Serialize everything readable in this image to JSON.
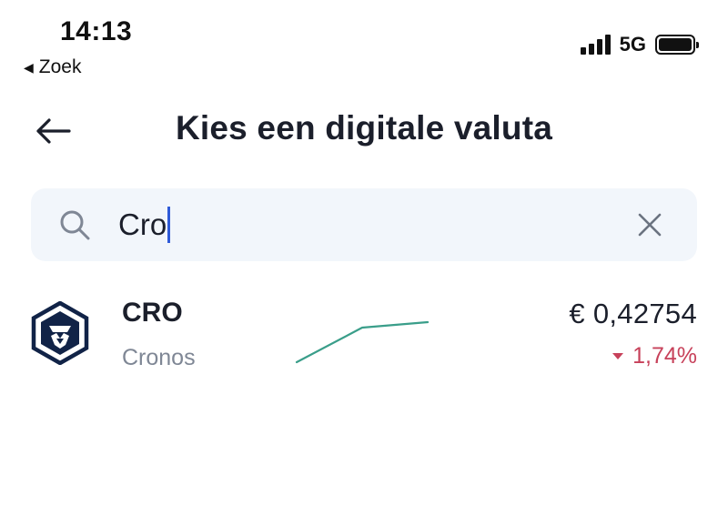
{
  "status_bar": {
    "time": "14:13",
    "back_app_label": "Zoek",
    "network": "5G"
  },
  "header": {
    "title": "Kies een digitale valuta",
    "back_icon": "arrow-left-icon"
  },
  "search": {
    "value": "Cro",
    "icon": "search-icon",
    "clear_icon": "close-icon"
  },
  "results": [
    {
      "symbol": "CRO",
      "name": "Cronos",
      "price": "€ 0,42754",
      "change": "1,74%",
      "change_direction": "down",
      "sparkline_color": "#3a9e8a"
    }
  ],
  "colors": {
    "accent": "#2f5bd8",
    "negative": "#c7415a",
    "logo": "#112347",
    "search_bg": "#f2f6fb"
  }
}
